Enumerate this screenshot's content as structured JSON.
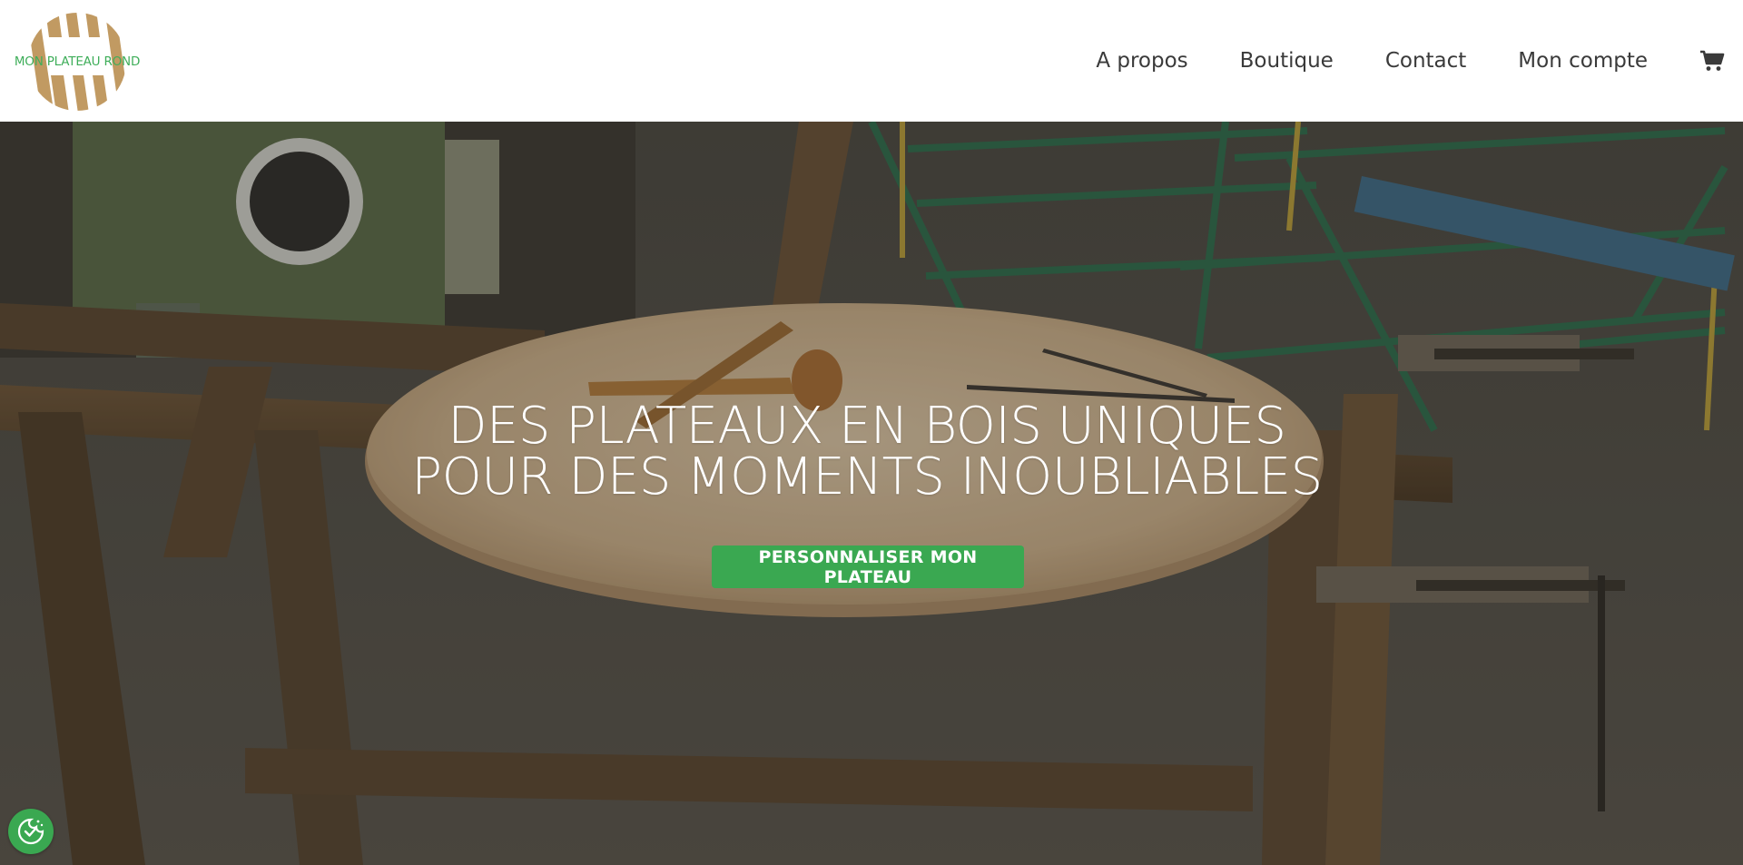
{
  "brand": {
    "logo_text": "MON PLATEAU ROND",
    "logo_icon": "wood-round-logo-icon",
    "text_color": "#3fae5a",
    "wood_color": "#c19a62"
  },
  "nav": {
    "items": [
      {
        "label": "A propos"
      },
      {
        "label": "Boutique"
      },
      {
        "label": "Contact"
      },
      {
        "label": "Mon compte"
      }
    ],
    "cart_icon": "cart-icon"
  },
  "hero": {
    "headline_line1": "DES PLATEAUX EN BOIS UNIQUES",
    "headline_line2": "POUR DES MOMENTS INOUBLIABLES",
    "cta_label": "PERSONNALISER MON PLATEAU",
    "accent": "#3aa851",
    "background": "woodworking-workshop-photo"
  },
  "cookie": {
    "icon": "cookie-consent-icon"
  }
}
